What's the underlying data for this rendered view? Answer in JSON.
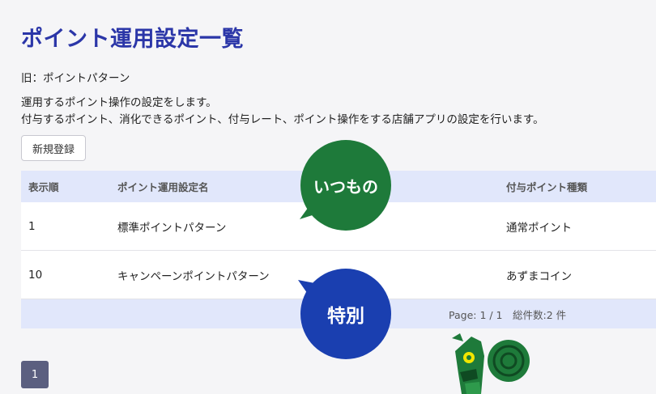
{
  "page": {
    "title": "ポイント運用設定一覧",
    "subtitle": "旧：ポイントパターン",
    "description_line1": "運用するポイント操作の設定をします。",
    "description_line2": "付与するポイント、消化できるポイント、付与レート、ポイント操作をする店舗アプリの設定を行います。",
    "new_button": "新規登録"
  },
  "table": {
    "headers": [
      "表示順",
      "ポイント運用設定名",
      "付与ポイント種類"
    ],
    "rows": [
      {
        "order": "1",
        "name": "標準ポイントパターン",
        "type": "通常ポイント"
      },
      {
        "order": "10",
        "name": "キャンペーンポイントパターン",
        "type": "あずまコイン"
      }
    ],
    "footer": "Page: 1 / 1　総件数:2 件"
  },
  "pagination": {
    "current": "1"
  },
  "callouts": {
    "green": "いつもの",
    "blue": "特別",
    "green_color": "#1e7a3a",
    "blue_color": "#1a3fb0"
  },
  "mascot": {
    "icon": "squirrel-mascot-icon"
  }
}
